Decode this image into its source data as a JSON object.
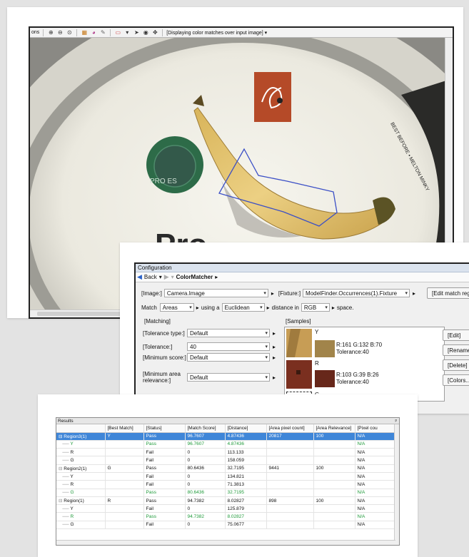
{
  "viewer": {
    "toolbar_prefix": "ons",
    "status": "[Displaying color matches over input image]",
    "status_arrow": "▾",
    "icons": [
      "zoom-in-icon",
      "zoom-out-icon",
      "zoom-fit-icon",
      "image-icon",
      "color-icon",
      "pipette-icon",
      "region-icon",
      "pointer-icon",
      "pan-icon",
      "move-icon"
    ],
    "scene": {
      "brand_text": "Pro",
      "rim_text": "BEST BEFORE • MELTON MINKY",
      "badge_text": "PRO ES"
    }
  },
  "config": {
    "title": "Configuration",
    "back_label": "Back",
    "breadcrumb": "ColorMatcher",
    "image_label": "[Image:]",
    "image_value": "Camera.Image",
    "fixture_label": "[Fixture:]",
    "fixture_value": "ModelFinder.Occurrences(1).Fixture",
    "edit_match_label": "[Edit match regions...",
    "match_label": "Match",
    "match_value": "Areas",
    "using_label": "using a",
    "metric_value": "Euclidean",
    "distance_label": "distance in",
    "space_value": "RGB",
    "space_suffix": "space.",
    "matching_header": "[Matching]",
    "samples_header": "[Samples]",
    "params": [
      {
        "label": "[Tolerance type:]",
        "value": "Default"
      },
      {
        "label": "[Tolerance:]",
        "value": "40"
      },
      {
        "label": "[Minimum score:]",
        "value": "Default"
      },
      {
        "label": "[Minimum area relevance:]",
        "value": "Default"
      }
    ],
    "samples": [
      {
        "name": "Y",
        "rgb": "R:161 G:132 B:70",
        "tolerance": "Tolerance:40",
        "color": "#a1844a"
      },
      {
        "name": "R",
        "rgb": "R:103 G:39 B:26",
        "tolerance": "Tolerance:40",
        "color": "#67271a"
      },
      {
        "name": "G",
        "rgb": "",
        "tolerance": "",
        "color": "#ffffff"
      }
    ],
    "buttons": [
      "[Edit]",
      "[Rename",
      "[Delete]",
      "[Colors..."
    ]
  },
  "results": {
    "title": "Results",
    "pin": "ᵖ",
    "columns": [
      "",
      "[Best Match]",
      "[Status]",
      "[Match Score]",
      "[Distance]",
      "[Area pixel count]",
      "[Area Relevance]",
      "[Pixel cou"
    ],
    "rows": [
      {
        "kind": "parent",
        "name": "Region3(1)",
        "best": "Y",
        "status": "Pass",
        "score": "96.7607",
        "distance": "4.87436",
        "area": "20817",
        "relevance": "100",
        "pixel": "N/A",
        "selected": true,
        "pass": false
      },
      {
        "kind": "child",
        "name": "Y",
        "best": "",
        "status": "Pass",
        "score": "96.7607",
        "distance": "4.87436",
        "area": "",
        "relevance": "",
        "pixel": "N/A",
        "selected": false,
        "pass": true
      },
      {
        "kind": "child",
        "name": "R",
        "best": "",
        "status": "Fail",
        "score": "0",
        "distance": "113.133",
        "area": "",
        "relevance": "",
        "pixel": "N/A",
        "selected": false,
        "pass": false
      },
      {
        "kind": "child",
        "name": "G",
        "best": "",
        "status": "Fail",
        "score": "0",
        "distance": "158.059",
        "area": "",
        "relevance": "",
        "pixel": "N/A",
        "selected": false,
        "pass": false
      },
      {
        "kind": "parent",
        "name": "Region2(1)",
        "best": "G",
        "status": "Pass",
        "score": "80.6436",
        "distance": "32.7195",
        "area": "9441",
        "relevance": "100",
        "pixel": "N/A",
        "selected": false,
        "pass": false
      },
      {
        "kind": "child",
        "name": "Y",
        "best": "",
        "status": "Fail",
        "score": "0",
        "distance": "134.821",
        "area": "",
        "relevance": "",
        "pixel": "N/A",
        "selected": false,
        "pass": false
      },
      {
        "kind": "child",
        "name": "R",
        "best": "",
        "status": "Fail",
        "score": "0",
        "distance": "71.3813",
        "area": "",
        "relevance": "",
        "pixel": "N/A",
        "selected": false,
        "pass": false
      },
      {
        "kind": "child",
        "name": "G",
        "best": "",
        "status": "Pass",
        "score": "80.6436",
        "distance": "32.7195",
        "area": "",
        "relevance": "",
        "pixel": "N/A",
        "selected": false,
        "pass": true
      },
      {
        "kind": "parent",
        "name": "Region(1)",
        "best": "R",
        "status": "Pass",
        "score": "94.7382",
        "distance": "8.02827",
        "area": "898",
        "relevance": "100",
        "pixel": "N/A",
        "selected": false,
        "pass": false
      },
      {
        "kind": "child",
        "name": "Y",
        "best": "",
        "status": "Fail",
        "score": "0",
        "distance": "125.879",
        "area": "",
        "relevance": "",
        "pixel": "N/A",
        "selected": false,
        "pass": false
      },
      {
        "kind": "child",
        "name": "R",
        "best": "",
        "status": "Pass",
        "score": "94.7382",
        "distance": "8.02827",
        "area": "",
        "relevance": "",
        "pixel": "N/A",
        "selected": false,
        "pass": true
      },
      {
        "kind": "child",
        "name": "G",
        "best": "",
        "status": "Fail",
        "score": "0",
        "distance": "75.0677",
        "area": "",
        "relevance": "",
        "pixel": "N/A",
        "selected": false,
        "pass": false
      }
    ]
  }
}
